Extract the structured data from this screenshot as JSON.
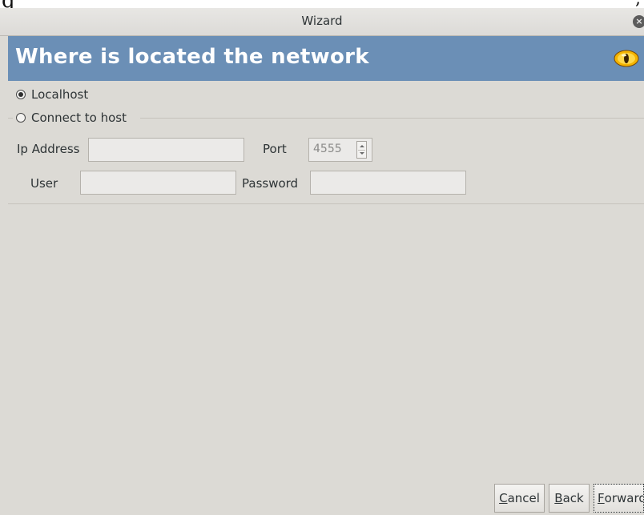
{
  "window": {
    "title": "Wizard"
  },
  "header": {
    "heading": "Where is located the network"
  },
  "radios": {
    "localhost": {
      "label": "Localhost",
      "checked": true
    },
    "connect": {
      "label": "Connect to host",
      "checked": false
    }
  },
  "form": {
    "ip_label": "Ip Address",
    "ip_value": "",
    "port_label": "Port",
    "port_value": "4555",
    "user_label": "User",
    "user_value": "",
    "password_label": "Password",
    "password_value": ""
  },
  "buttons": {
    "cancel": {
      "mnemonic": "C",
      "rest": "ancel"
    },
    "back": {
      "mnemonic": "B",
      "rest": "ack"
    },
    "forward": {
      "mnemonic": "F",
      "rest": "orward"
    }
  },
  "icons": {
    "close": "close-icon",
    "logo": "eye-logo-icon"
  },
  "colors": {
    "banner": "#6b8fb6",
    "logo_outer": "#f5b400"
  }
}
